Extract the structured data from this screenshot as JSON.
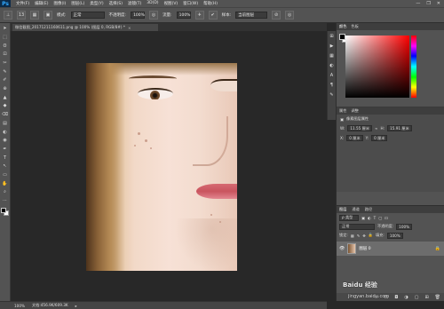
{
  "app": {
    "logo": "Ps"
  },
  "menu": [
    "文件(F)",
    "编辑(E)",
    "图像(I)",
    "图层(L)",
    "类型(Y)",
    "选择(S)",
    "滤镜(T)",
    "3D(D)",
    "视图(V)",
    "窗口(W)",
    "帮助(H)"
  ],
  "window_controls": [
    "—",
    "❐",
    "✕"
  ],
  "options": {
    "size": "13",
    "mode_label": "模式:",
    "mode_value": "正常",
    "opacity_label": "不透明度:",
    "opacity_value": "100%",
    "flow_label": "流量:",
    "flow_value": "100%",
    "sample_label": "样本:",
    "sample_value": "当前图层"
  },
  "document": {
    "tab_title": "微信截图_20171211160611.png @ 100% (图层 0, RGB/8#) *",
    "close": "×",
    "zoom": "100%",
    "doc_info": "文档:456.9K/609.3K"
  },
  "tools": [
    "➤",
    "⬚",
    "ʘ",
    "⊡",
    "✂",
    "✎",
    "✐",
    "⊕",
    "▲",
    "◆",
    "⌫",
    "▤",
    "◐",
    "◉",
    "✒",
    "T",
    "↖",
    "▭",
    "✋",
    "⌕",
    "⋯"
  ],
  "panels": {
    "color_tabs": [
      "颜色",
      "色板"
    ],
    "props_tabs": [
      "属性",
      "调整"
    ],
    "props_title": "像素图层属性",
    "props_w_label": "W:",
    "props_w_value": "11.55 厘米",
    "props_h_label": "H:",
    "props_h_value": "15.91 厘米",
    "props_x_label": "X:",
    "props_x_value": "0 厘米",
    "props_y_label": "Y:",
    "props_y_value": "0 厘米"
  },
  "layers": {
    "tabs": [
      "图层",
      "通道",
      "路径"
    ],
    "filter_label": "ρ 类型",
    "blend_mode": "正常",
    "opacity_label": "不透明度:",
    "opacity_value": "100%",
    "lock_label": "锁定:",
    "fill_label": "填充:",
    "fill_value": "100%",
    "layer_name": "图层 0",
    "bottom_icons": [
      "∞",
      "fx",
      "◘",
      "◑",
      "▢",
      "⊞",
      "🗑"
    ]
  },
  "watermark": {
    "text": "Baidu 经验",
    "url": "jingyan.baidu.com"
  }
}
